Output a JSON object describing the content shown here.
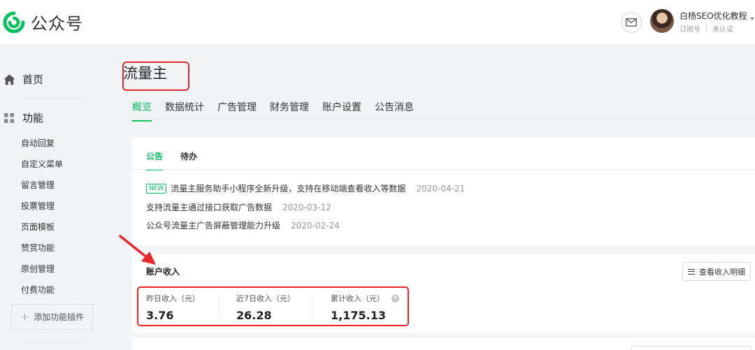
{
  "app": {
    "name": "公众号",
    "brand_color": "#07c160"
  },
  "account": {
    "name": "白杨SEO优化教程",
    "type": "订阅号",
    "verification": "未认证"
  },
  "sidebar": {
    "home_label": "首页",
    "features_label": "功能",
    "items": [
      "自动回复",
      "自定义菜单",
      "留言管理",
      "投票管理",
      "页面模板",
      "赞赏功能",
      "原创管理",
      "付费功能"
    ],
    "add_plugin_label": "添加功能插件"
  },
  "page": {
    "title": "流量主",
    "tabs": [
      "概览",
      "数据统计",
      "广告管理",
      "财务管理",
      "账户设置",
      "公告消息"
    ],
    "active_tab": "概览"
  },
  "notices": {
    "tabs": [
      "公告",
      "待办"
    ],
    "new_badge": "NEW",
    "items": [
      {
        "text": "流量主服务助手小程序全新升级，支持在移动端查看收入等数据",
        "date": "2020-04-21"
      },
      {
        "text": "支持流量主通过接口获取广告数据",
        "date": "2020-03-12"
      },
      {
        "text": "公众号流量主广告屏蔽管理能力升级",
        "date": "2020-02-24"
      }
    ]
  },
  "income": {
    "title": "账户收入",
    "detail_button": "查看收入明细",
    "stats": [
      {
        "label": "昨日收入（元）",
        "value": "3.76"
      },
      {
        "label": "近7日收入（元）",
        "value": "26.28"
      },
      {
        "label": "累计收入（元）",
        "value": "1,175.13"
      }
    ],
    "help_glyph": "?"
  },
  "annotation_color": "#e8252b"
}
